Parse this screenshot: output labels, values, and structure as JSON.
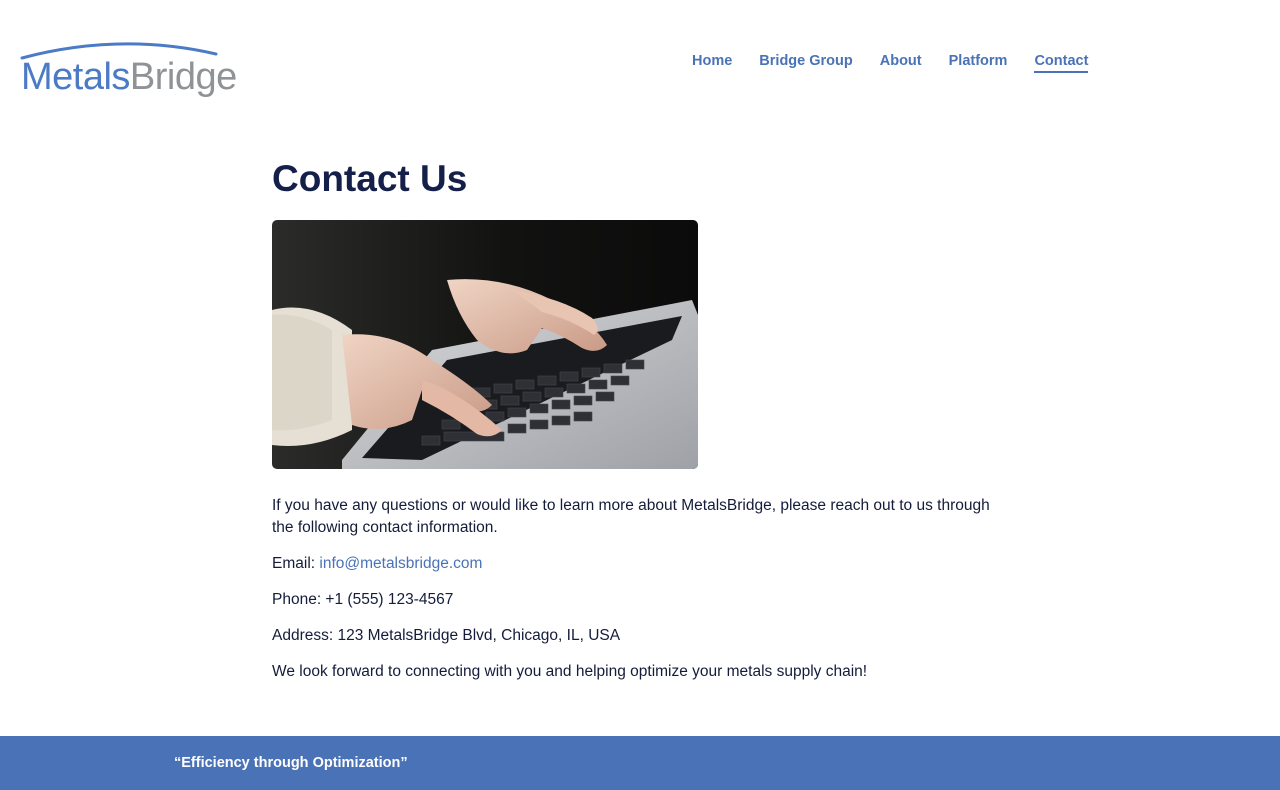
{
  "header": {
    "logo": {
      "word1": "Metals",
      "word2": "Bridge"
    },
    "nav": [
      {
        "label": "Home"
      },
      {
        "label": "Bridge Group"
      },
      {
        "label": "About"
      },
      {
        "label": "Platform"
      },
      {
        "label": "Contact",
        "active": true
      }
    ]
  },
  "main": {
    "title": "Contact Us",
    "intro": "If you have any questions or would like to learn more about MetalsBridge, please reach out to us through the following contact information.",
    "email_label": "Email: ",
    "email_value": "info@metalsbridge.com",
    "phone": "Phone: +1 (555) 123-4567",
    "address": "Address: 123 MetalsBridge Blvd, Chicago, IL, USA",
    "closing": "We look forward to connecting with you and helping optimize your metals supply chain!"
  },
  "footer": {
    "tagline": "“Efficiency through Optimization”"
  },
  "colors": {
    "brand_blue": "#4a72b6",
    "title_navy": "#15204a",
    "logo_gray": "#8f9296"
  }
}
